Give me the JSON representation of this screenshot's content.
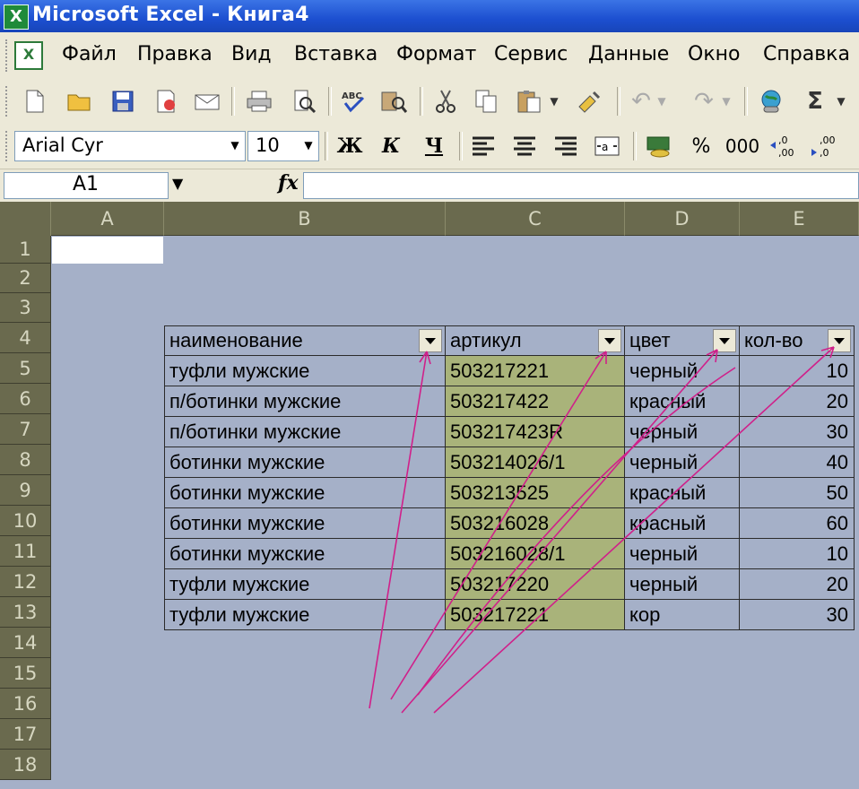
{
  "app": {
    "title": "Microsoft Excel - Книга4",
    "icon": "excel-icon"
  },
  "menu": [
    "Файл",
    "Правка",
    "Вид",
    "Вставка",
    "Формат",
    "Сервис",
    "Данные",
    "Окно",
    "Справка"
  ],
  "formatting": {
    "font_name": "Arial Cyr",
    "font_size": "10",
    "bold": "Ж",
    "italic": "К",
    "underline": "Ч",
    "percent": "%",
    "thousands": "000"
  },
  "formula_bar": {
    "name_box": "A1",
    "fx": "fx",
    "value": ""
  },
  "columns": [
    "A",
    "B",
    "C",
    "D",
    "E"
  ],
  "rows": [
    "1",
    "2",
    "3",
    "4",
    "5",
    "6",
    "7",
    "8",
    "9",
    "10",
    "11",
    "12",
    "13",
    "14",
    "15",
    "16",
    "17",
    "18"
  ],
  "table": {
    "headers": [
      "наименование",
      "артикул",
      "цвет",
      "кол-во"
    ],
    "rows": [
      [
        "туфли мужские",
        "503217221",
        "черный",
        "10"
      ],
      [
        "п/ботинки мужские",
        "503217422",
        "красный",
        "20"
      ],
      [
        "п/ботинки мужские",
        "503217423R",
        "черный",
        "30"
      ],
      [
        "ботинки мужские",
        "503214026/1",
        "черный",
        "40"
      ],
      [
        "ботинки мужские",
        "503213525",
        "красный",
        "50"
      ],
      [
        "ботинки мужские",
        "503216028",
        "красный",
        "60"
      ],
      [
        "ботинки мужские",
        "503216028/1",
        "черный",
        "10"
      ],
      [
        "туфли мужские",
        "503217220",
        "черный",
        "20"
      ],
      [
        "туфли мужские",
        "503217221",
        "кор",
        "30"
      ]
    ]
  },
  "colors": {
    "title_bar": "#1c4fd0",
    "grid_background": "#a5b0c8",
    "header_background": "#6a6a4e",
    "article_column": "#a9b37a",
    "annotation_arrows": "#d0208a"
  }
}
